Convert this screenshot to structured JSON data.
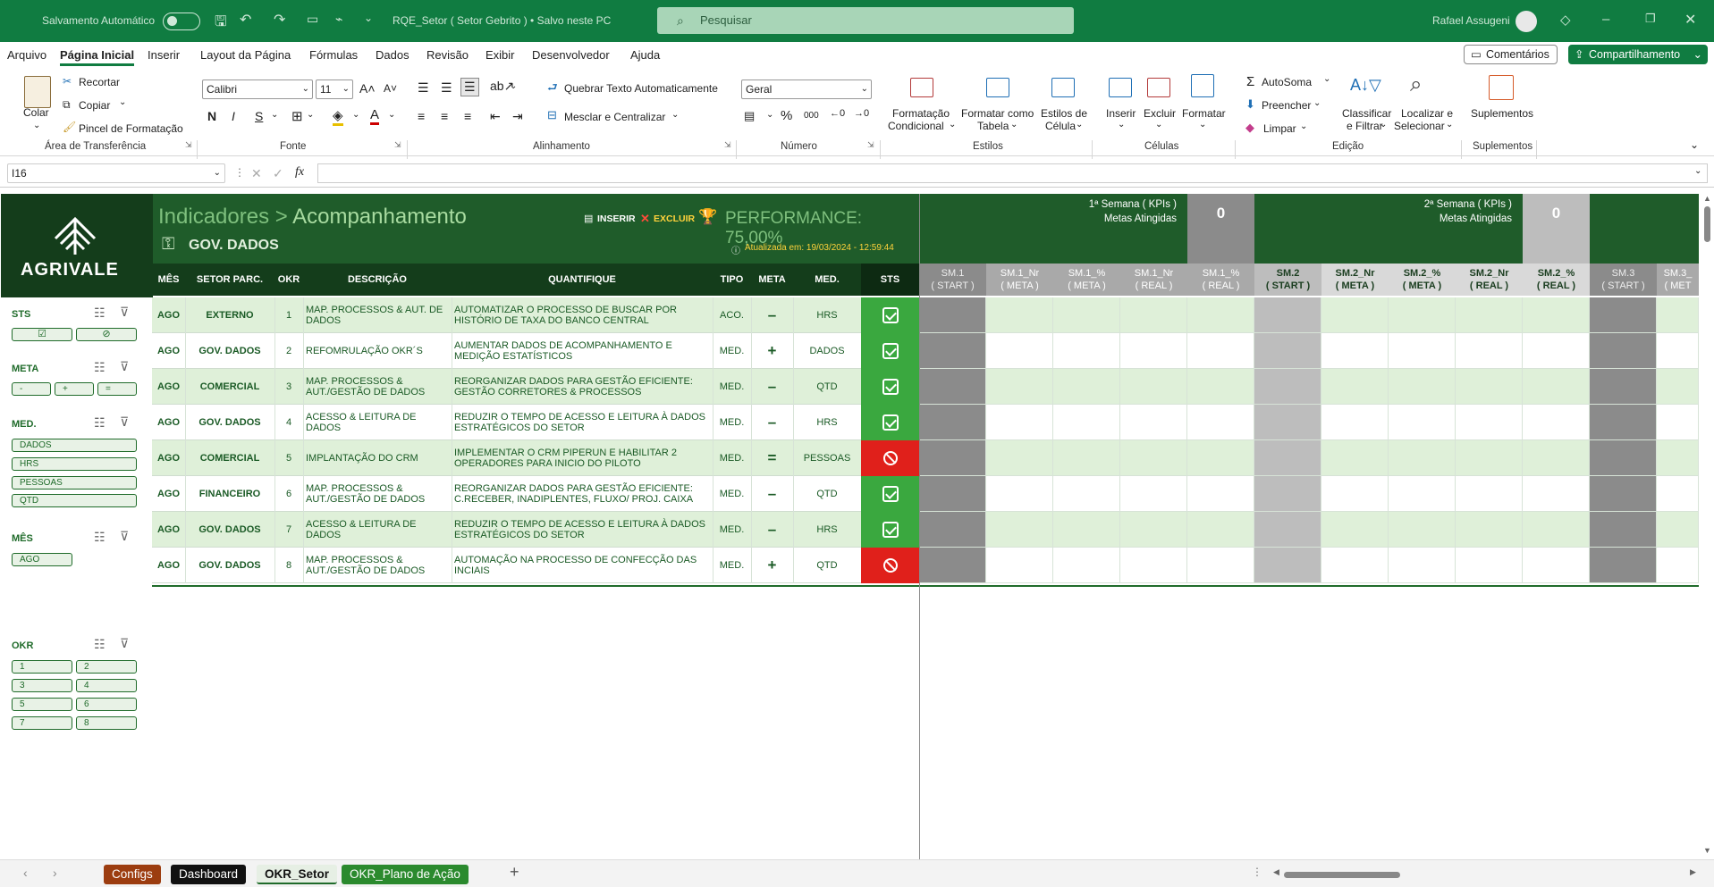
{
  "titlebar": {
    "autosave": "Salvamento Automático",
    "filename": "RQE_Setor ( Setor Gebrito ) • Salvo neste PC",
    "search_placeholder": "Pesquisar",
    "user": "Rafael Assugeni"
  },
  "menu": [
    "Arquivo",
    "Página Inicial",
    "Inserir",
    "Layout da Página",
    "Fórmulas",
    "Dados",
    "Revisão",
    "Exibir",
    "Desenvolvedor",
    "Ajuda"
  ],
  "comments": "Comentários",
  "share": "Compartilhamento",
  "ribbon": {
    "colar": "Colar",
    "recortar": "Recortar",
    "copiar": "Copiar",
    "pincel": "Pincel de Formatação",
    "area": "Área de Transferência",
    "font_name": "Calibri",
    "font_size": "11",
    "fonte": "Fonte",
    "quebrar": "Quebrar Texto Automaticamente",
    "mesclar": "Mesclar e Centralizar",
    "alinhamento": "Alinhamento",
    "geral": "Geral",
    "numero": "Número",
    "form_cond": "Formatação",
    "form_cond2": "Condicional",
    "form_tab": "Formatar como",
    "form_tab2": "Tabela",
    "estilos_cel": "Estilos de",
    "estilos_cel2": "Célula",
    "estilos": "Estilos",
    "inserir": "Inserir",
    "excluir": "Excluir",
    "formatar": "Formatar",
    "celulas": "Células",
    "autosoma": "AutoSoma",
    "preencher": "Preencher",
    "limpar": "Limpar",
    "classificar": "Classificar",
    "classificar2": "e Filtrar",
    "localizar": "Localizar e",
    "localizar2": "Selecionar",
    "edicao": "Edição",
    "suplementos": "Suplementos",
    "suplementos_g": "Suplementos"
  },
  "namebox": "I16",
  "dashboard": {
    "logo": "AGRIVALE",
    "title_a": "Indicadores > ",
    "title_b": "Acompanhamento",
    "sector": "GOV. DADOS",
    "inserir": "INSERIR",
    "excluir": "EXCLUIR",
    "performance": "PERFORMANCE: 75,00%",
    "updated": "Atualizada em: 19/03/2024 - 12:59:44"
  },
  "columns": [
    "MÊS",
    "SETOR PARC.",
    "OKR",
    "DESCRIÇÃO",
    "QUANTIFIQUE",
    "TIPO",
    "META",
    "MED.",
    "STS"
  ],
  "rows": [
    {
      "mes": "AGO",
      "setor": "EXTERNO",
      "okr": "1",
      "desc": "MAP. PROCESSOS & AUT. DE DADOS",
      "quant": "AUTOMATIZAR O PROCESSO DE BUSCAR POR HISTÓRIO DE TAXA DO BANCO CENTRAL",
      "tipo": "ACO.",
      "meta": "–",
      "med": "HRS",
      "sts": "ok"
    },
    {
      "mes": "AGO",
      "setor": "GOV. DADOS",
      "okr": "2",
      "desc": "REFOMRULAÇÃO OKR´S",
      "quant": "AUMENTAR DADOS DE ACOMPANHAMENTO E MEDIÇÃO ESTATÍSTICOS",
      "tipo": "MED.",
      "meta": "+",
      "med": "DADOS",
      "sts": "ok"
    },
    {
      "mes": "AGO",
      "setor": "COMERCIAL",
      "okr": "3",
      "desc": "MAP. PROCESSOS & AUT./GESTÃO DE DADOS",
      "quant": "REORGANIZAR DADOS PARA GESTÃO EFICIENTE: GESTÃO CORRETORES & PROCESSOS",
      "tipo": "MED.",
      "meta": "–",
      "med": "QTD",
      "sts": "ok"
    },
    {
      "mes": "AGO",
      "setor": "GOV. DADOS",
      "okr": "4",
      "desc": "ACESSO & LEITURA DE DADOS",
      "quant": "REDUZIR O TEMPO DE ACESSO E LEITURA À DADOS ESTRATÉGICOS DO SETOR",
      "tipo": "MED.",
      "meta": "–",
      "med": "HRS",
      "sts": "ok"
    },
    {
      "mes": "AGO",
      "setor": "COMERCIAL",
      "okr": "5",
      "desc": "IMPLANTAÇÃO DO CRM",
      "quant": "IMPLEMENTAR O CRM PIPERUN E HABILITAR 2 OPERADORES PARA INICIO DO PILOTO",
      "tipo": "MED.",
      "meta": "=",
      "med": "PESSOAS",
      "sts": "no"
    },
    {
      "mes": "AGO",
      "setor": "FINANCEIRO",
      "okr": "6",
      "desc": "MAP. PROCESSOS & AUT./GESTÃO DE DADOS",
      "quant": "REORGANIZAR DADOS PARA GESTÃO EFICIENTE: C.RECEBER, INADIPLENTES, FLUXO/ PROJ. CAIXA",
      "tipo": "MED.",
      "meta": "–",
      "med": "QTD",
      "sts": "ok"
    },
    {
      "mes": "AGO",
      "setor": "GOV. DADOS",
      "okr": "7",
      "desc": "ACESSO & LEITURA DE DADOS",
      "quant": "REDUZIR O TEMPO DE ACESSO E LEITURA À DADOS ESTRATÉGICOS DO SETOR",
      "tipo": "MED.",
      "meta": "–",
      "med": "HRS",
      "sts": "ok"
    },
    {
      "mes": "AGO",
      "setor": "GOV. DADOS",
      "okr": "8",
      "desc": "MAP. PROCESSOS & AUT./GESTÃO DE DADOS",
      "quant": "AUTOMAÇÃO NA PROCESSO DE CONFECÇÃO DAS INCIAIS",
      "tipo": "MED.",
      "meta": "+",
      "med": "QTD",
      "sts": "no"
    }
  ],
  "weeks": [
    {
      "label": "1ª Semana ( KPIs )",
      "sub": "Metas Atingidas",
      "count": "0"
    },
    {
      "label": "2ª Semana ( KPIs )",
      "sub": "Metas Atingidas",
      "count": "0"
    }
  ],
  "week_cols": [
    [
      "SM.1",
      "( START )"
    ],
    [
      "SM.1_Nr",
      "( META )"
    ],
    [
      "SM.1_%",
      "( META )"
    ],
    [
      "SM.1_Nr",
      "( REAL )"
    ],
    [
      "SM.1_%",
      "( REAL )"
    ],
    [
      "SM.2",
      "( START )"
    ],
    [
      "SM.2_Nr",
      "( META )"
    ],
    [
      "SM.2_%",
      "( META )"
    ],
    [
      "SM.2_Nr",
      "( REAL )"
    ],
    [
      "SM.2_%",
      "( REAL )"
    ],
    [
      "SM.3",
      "( START )"
    ],
    [
      "SM.3_",
      "( MET"
    ]
  ],
  "slicers": {
    "sts": "STS",
    "meta": "META",
    "meta_items": [
      "-",
      "+",
      "="
    ],
    "med": "MED.",
    "med_items": [
      "DADOS",
      "HRS",
      "PESSOAS",
      "QTD"
    ],
    "mes": "MÊS",
    "mes_items": [
      "AGO"
    ],
    "okr": "OKR",
    "okr_items": [
      "1",
      "2",
      "3",
      "4",
      "5",
      "6",
      "7",
      "8"
    ]
  },
  "tabs": [
    "Configs",
    "Dashboard",
    "OKR_Setor",
    "OKR_Plano de Ação"
  ],
  "colors": {
    "excel_green": "#107c41",
    "dark": "#143d1b",
    "ok": "#3aa83f",
    "no": "#e0201b"
  }
}
